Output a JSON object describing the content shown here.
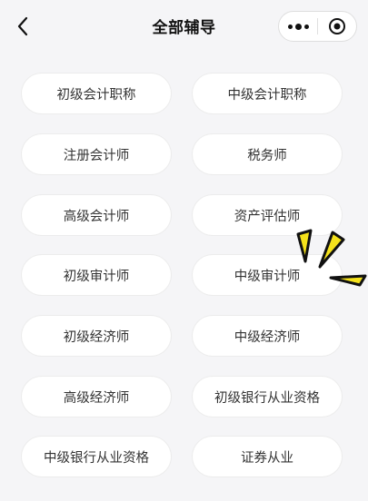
{
  "header": {
    "title": "全部辅导",
    "back_icon": "chevron-left-icon",
    "more_icon": "more-dots-icon",
    "close_icon": "target-circle-icon"
  },
  "categories": [
    "初级会计职称",
    "中级会计职称",
    "注册会计师",
    "税务师",
    "高级会计师",
    "资产评估师",
    "初级审计师",
    "中级审计师",
    "初级经济师",
    "中级经济师",
    "高级经济师",
    "初级银行从业资格",
    "中级银行从业资格",
    "证券从业"
  ],
  "decoration": {
    "sparkle_icon": "sparkle-icon",
    "sparkle_color": "#f5e21b"
  },
  "colors": {
    "background": "#f5f5f7",
    "pill_background": "#ffffff",
    "text": "#333333"
  }
}
